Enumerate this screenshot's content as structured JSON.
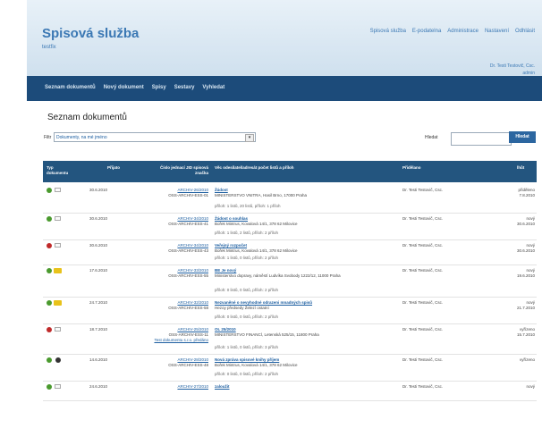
{
  "app": {
    "title": "Spisová služba",
    "subtitle": "testfix"
  },
  "top_menu": [
    "Spisová služba",
    "E-podatelna",
    "Administrace",
    "Nastavení",
    "Odhlásit"
  ],
  "user": {
    "line1": "Dr. Testi Testovič, Csc.",
    "line2": "admin"
  },
  "nav": [
    "Seznam dokumentů",
    "Nový dokument",
    "Spisy",
    "Sestavy",
    "Vyhledat"
  ],
  "page_title": "Seznam dokumentů",
  "filter": {
    "label": "Filtr",
    "value": "Dokumenty, na mé jméno"
  },
  "search": {
    "label": "Hledat",
    "placeholder": "",
    "button": "Hledat"
  },
  "table": {
    "headers": {
      "type": "Typ dokumentu",
      "received": "Přijato",
      "cj": "Číslo jednací JID spisová značka",
      "vec": "Věc odesílatel/adresát počet listů a příloh",
      "handler": "Přidělano",
      "due": "lhůt"
    },
    "rows": [
      {
        "received": "30.6.2010",
        "cj": "ARCHIV-26/2010",
        "jid": "OSS-ARCHIV-ESS-01",
        "extra": "",
        "subject": "Žádost",
        "sender": "MINISTERSTVO VNITRA, Hasil Brno, 17000 Praha",
        "info": "příloh: 1 listů, 20 listů, příloh: 1 příloh",
        "handler": "Dr. Testi Testovič, Csc.",
        "status": "přiděleno",
        "status_date": "7.8.2010",
        "type_color": "#4a9a2e",
        "second_icon": "box"
      },
      {
        "received": "30.6.2010",
        "cj": "ARCHIV-34/2010",
        "jid": "OSS-ARCHIV-ESS-41",
        "extra": "",
        "subject": "Žádost o souhlas",
        "sender": "Bořek Mintrus, Kovalová 14/1, 378 62 Milovice",
        "info": "příloh: 1 listů, 2 listů, příloh: 2 příloh",
        "handler": "Dr. Testi Testovič, Csc.",
        "status": "nový",
        "status_date": "30.6.2010",
        "type_color": "#4a9a2e",
        "second_icon": "box"
      },
      {
        "received": "30.6.2010",
        "cj": "ARCHIV-34/2010",
        "jid": "OSS-ARCHIV-ESS-43",
        "extra": "",
        "subject": "Veřejný rozpočet",
        "sender": "Bořek Mintrus, Kovalová 14/1, 378 62 Milovice",
        "info": "příloh: 1 listů, 0 listů, příloh: 2 příloh",
        "handler": "Dr. Testi Testovič, Csc.",
        "status": "nový",
        "status_date": "30.6.2010",
        "type_color": "#c02a2a",
        "second_icon": "box"
      },
      {
        "received": "17.6.2010",
        "cj": "ARCHIV-33/2010",
        "jid": "OSS-ARCHIV-ESS-55",
        "extra": "",
        "subject": "BE Je nový",
        "sender": "Ministerstvo dopravy, náměstí Ludvíka Svobody 1222/12, 11000 Praha",
        "info": "příloh: 0 listů, 0 listů, příloh: 2 příloh",
        "handler": "Dr. Testi Testovič, Csc.",
        "status": "nový",
        "status_date": "19.6.2010",
        "type_color": "#4a9a2e",
        "second_icon": "flag"
      },
      {
        "received": "24.7.2010",
        "cj": "ARCHIV-32/2010",
        "jid": "OSS-ARCHIV-ESS-58",
        "extra": "",
        "subject": "Nezvaněné o nevyhodné odrazeni mnadných spisů",
        "sender": "Hezoy předsedy Železí ostatní",
        "info": "příloh: 0 listů, 0 listů, příloh: 2 příloh",
        "handler": "Dr. Testi Testovič, Csc.",
        "status": "nový",
        "status_date": "21.7.2010",
        "type_color": "#4a9a2e",
        "second_icon": "flag"
      },
      {
        "received": "18.7.2010",
        "cj": "ARCHIV-25/2010",
        "jid": "OSS-ARCHIV-ESS-11",
        "extra": "Test dokumentu s.r.o. předáno",
        "subject": "OL 25/2010",
        "sender": "MINISTERSTVO FINANCÍ, Letenská 525/15, 11800 Praha",
        "info": "příloh: 1 listů, 0 listů, příloh: 3 příloh",
        "handler": "Dr. Testi Testovič, Csc.",
        "status": "vyřízeno",
        "status_date": "15.7.2010",
        "type_color": "#c02a2a",
        "second_icon": "box"
      },
      {
        "received": "14.6.2010",
        "cj": "ARCHIV-28/2010",
        "jid": "OSS-ARCHIV-ESS-48",
        "extra": "",
        "subject": "Nová zpráva spisové knihy příjem",
        "sender": "Bořek Mintrus, Kovalová 14/1, 378 62 Milovice",
        "info": "příloh: 0 listů, 0 listů, příloh: 2 příloh",
        "handler": "Dr. Testi Testovič, Csc.",
        "status": "vyřízeno",
        "status_date": "",
        "type_color": "#4a9a2e",
        "second_icon": "gear"
      },
      {
        "received": "24.6.2010",
        "cj": "ARCHIV-27/2010",
        "jid": "",
        "extra": "",
        "subject": "zaloužit",
        "sender": "",
        "info": "",
        "handler": "Dr. Testi Testovič, Csc.",
        "status": "nový",
        "status_date": "",
        "type_color": "#4a9a2e",
        "second_icon": "box"
      }
    ]
  }
}
